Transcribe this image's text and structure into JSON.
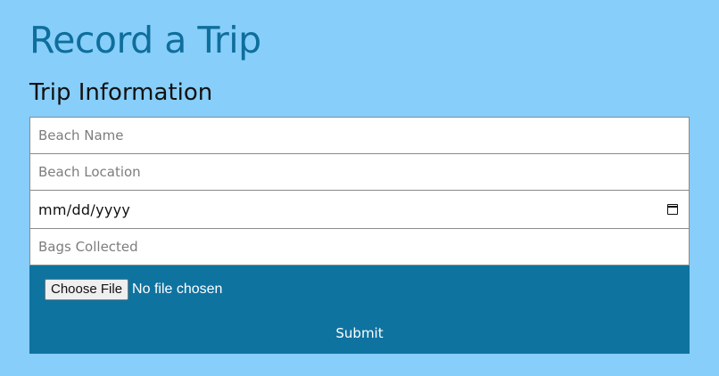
{
  "header": {
    "title": "Record a Trip",
    "section_title": "Trip Information"
  },
  "form": {
    "beach_name": {
      "placeholder": "Beach Name",
      "value": ""
    },
    "beach_location": {
      "placeholder": "Beach Location",
      "value": ""
    },
    "date": {
      "display": "mm/dd/yyyy",
      "icon": "calendar-icon"
    },
    "bags_collected": {
      "placeholder": "Bags Collected",
      "value": ""
    },
    "file_input": {
      "button_label": "Choose File",
      "status": "No file chosen"
    },
    "submit_label": "Submit"
  },
  "colors": {
    "background": "#87cefa",
    "title": "#0e6e9c",
    "panel": "#0f73a0"
  }
}
